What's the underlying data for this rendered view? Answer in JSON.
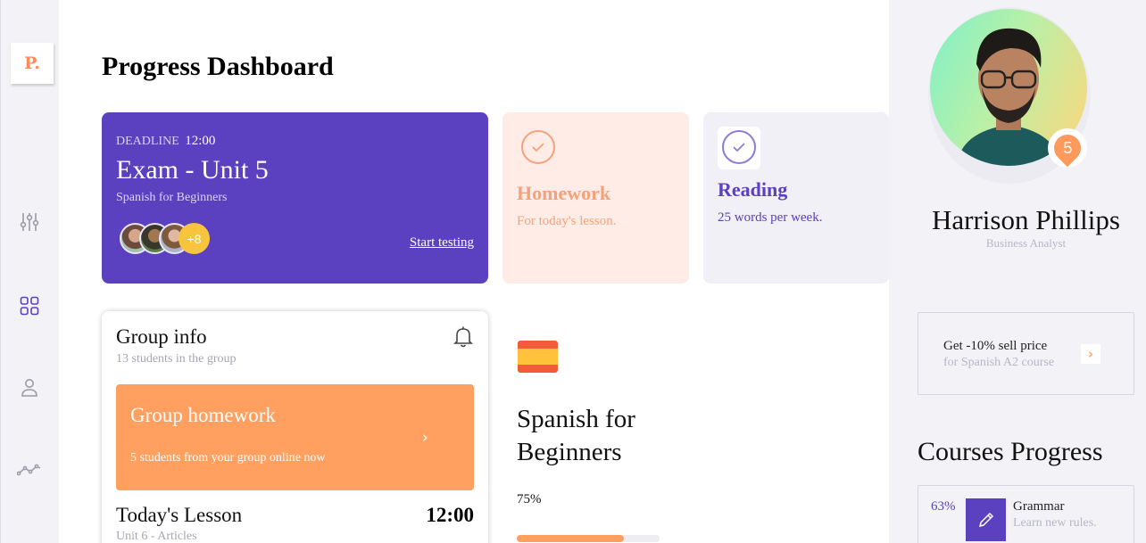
{
  "sidebar": {
    "logo": "P.",
    "items": [
      {
        "name": "filters",
        "icon": "sliders-icon"
      },
      {
        "name": "dashboard",
        "icon": "grid-icon"
      },
      {
        "name": "profile",
        "icon": "user-icon"
      },
      {
        "name": "statistics",
        "icon": "activity-icon"
      }
    ]
  },
  "header": {
    "title": "Progress Dashboard"
  },
  "exam": {
    "deadline_label": "DEADLINE",
    "deadline_time": "12:00",
    "title": "Exam - Unit 5",
    "subtitle": "Spanish for Beginners",
    "more_participants": "+8",
    "action": "Start testing"
  },
  "homework": {
    "title": "Homework",
    "subtitle": "For today's lesson.",
    "color": "#f5a27a"
  },
  "reading": {
    "title": "Reading",
    "subtitle": "25 words per week.",
    "color": "#5b40c0"
  },
  "group": {
    "title": "Group info",
    "subtitle": "13 students in the group",
    "homework_title": "Group homework",
    "homework_sub": "5 students from your group online now",
    "lesson_title": "Today's Lesson",
    "lesson_time": "12:00",
    "lesson_sub": "Unit 6 - Articles"
  },
  "course": {
    "title": "Spanish for Beginners",
    "progress_label": "75%",
    "progress": 0.75
  },
  "profile": {
    "name": "Harrison Phillips",
    "role": "Business Analyst",
    "level": "5"
  },
  "promo": {
    "title": "Get -10% sell price",
    "subtitle": "for Spanish A2 course"
  },
  "courses_progress": {
    "title": "Courses Progress",
    "items": [
      {
        "percent": "63%",
        "name": "Grammar",
        "subtitle": "Learn new rules."
      }
    ]
  },
  "colors": {
    "accent_purple": "#5b40c0",
    "accent_orange": "#ffa061",
    "homework_bg": "#ffece6"
  }
}
